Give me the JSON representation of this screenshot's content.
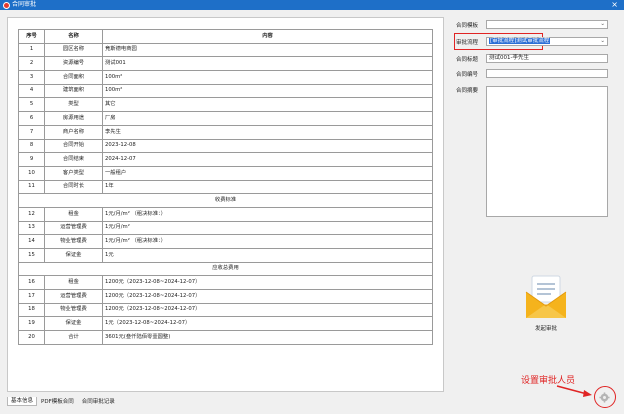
{
  "window": {
    "title": "合同审批",
    "close_label": "×"
  },
  "table": {
    "headers": {
      "no": "序号",
      "name": "名称",
      "content": "内容"
    },
    "rows": [
      {
        "no": "1",
        "name": "园区名称",
        "value": "竞斯德电商园"
      },
      {
        "no": "2",
        "name": "资源编号",
        "value": "测试001"
      },
      {
        "no": "3",
        "name": "合同面积",
        "value": "100m²"
      },
      {
        "no": "4",
        "name": "建筑面积",
        "value": "100m²"
      },
      {
        "no": "5",
        "name": "类型",
        "value": "其它"
      },
      {
        "no": "6",
        "name": "房源用途",
        "value": "厂房"
      },
      {
        "no": "7",
        "name": "商户名称",
        "value": "李先生"
      },
      {
        "no": "8",
        "name": "合同开始",
        "value": "2023-12-08"
      },
      {
        "no": "9",
        "name": "合同结束",
        "value": "2024-12-07"
      },
      {
        "no": "10",
        "name": "客户类型",
        "value": "一般租户"
      },
      {
        "no": "11",
        "name": "合同时长",
        "value": "1年"
      },
      {
        "section": "收费标准"
      },
      {
        "no": "12",
        "name": "租金",
        "value": "1元/月/m²  （租决标准：）"
      },
      {
        "no": "13",
        "name": "运营管理费",
        "value": "1元/月/m²"
      },
      {
        "no": "14",
        "name": "物业管理费",
        "value": "1元/月/m²  （租决标准：）"
      },
      {
        "no": "15",
        "name": "保证金",
        "value": "1元"
      },
      {
        "section": "应收总费用"
      },
      {
        "no": "16",
        "name": "租金",
        "value": "1200元（2023-12-08~2024-12-07）"
      },
      {
        "no": "17",
        "name": "运营管理费",
        "value": "1200元（2023-12-08~2024-12-07）"
      },
      {
        "no": "18",
        "name": "物业管理费",
        "value": "1200元（2023-12-08~2024-12-07）"
      },
      {
        "no": "19",
        "name": "保证金",
        "value": "1元（2023-12-08~2024-12-07）"
      },
      {
        "no": "20",
        "name": "合计",
        "value": "3601元(叁仟陆佰零壹圆整)"
      }
    ]
  },
  "form": {
    "template_label": "合同模板",
    "template_value": "",
    "flow_label": "审批流程",
    "flow_value": "[审批流程]测试审批流程",
    "title_label": "合同标题",
    "title_value": "测试001-李先生",
    "number_label": "合同编号",
    "number_value": "",
    "memo_label": "合同摘要",
    "memo_value": ""
  },
  "send": {
    "label": "发起审批"
  },
  "annotation": {
    "text": "设置审批人员"
  },
  "tabs": [
    "基本信息",
    "PDF模板合同",
    "合同审批记录"
  ],
  "colors": {
    "titlebar": "#1e6fc8",
    "annotation_red": "#e02424",
    "selection": "#2b6fd6"
  }
}
